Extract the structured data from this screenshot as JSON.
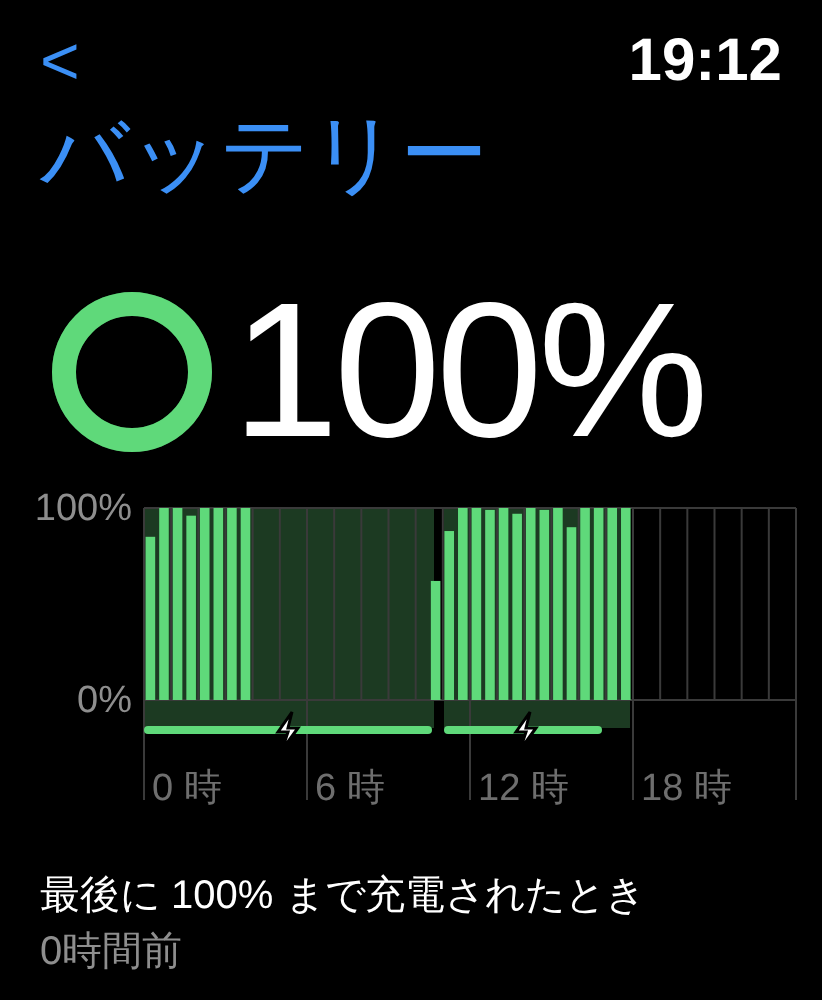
{
  "status_bar": {
    "back": "<",
    "time": "19:12"
  },
  "title": "バッテリー",
  "battery": {
    "percent": "100%"
  },
  "time_labels": [
    "0 時",
    "6 時",
    "12 時",
    "18 時"
  ],
  "chart_data": {
    "type": "bar",
    "ylim": [
      0,
      100
    ],
    "yticks": [
      {
        "value": 100,
        "label": "100%"
      },
      {
        "value": 0,
        "label": "0%"
      }
    ],
    "series": [
      {
        "color": "#5fd97a",
        "values": [
          85,
          100,
          100,
          96,
          100,
          100,
          100,
          100,
          null,
          null,
          null,
          null,
          null,
          null,
          null,
          null,
          null,
          null,
          null,
          null,
          null,
          62,
          88,
          100,
          100,
          99,
          100,
          97,
          100,
          99,
          100,
          90,
          100,
          100,
          100,
          100,
          null,
          null,
          null,
          null,
          null,
          null,
          null,
          null,
          null,
          null,
          null,
          null
        ]
      }
    ]
  },
  "last_full_charge": {
    "label": "最後に 100% まで充電されたとき",
    "value": "0時間前"
  }
}
